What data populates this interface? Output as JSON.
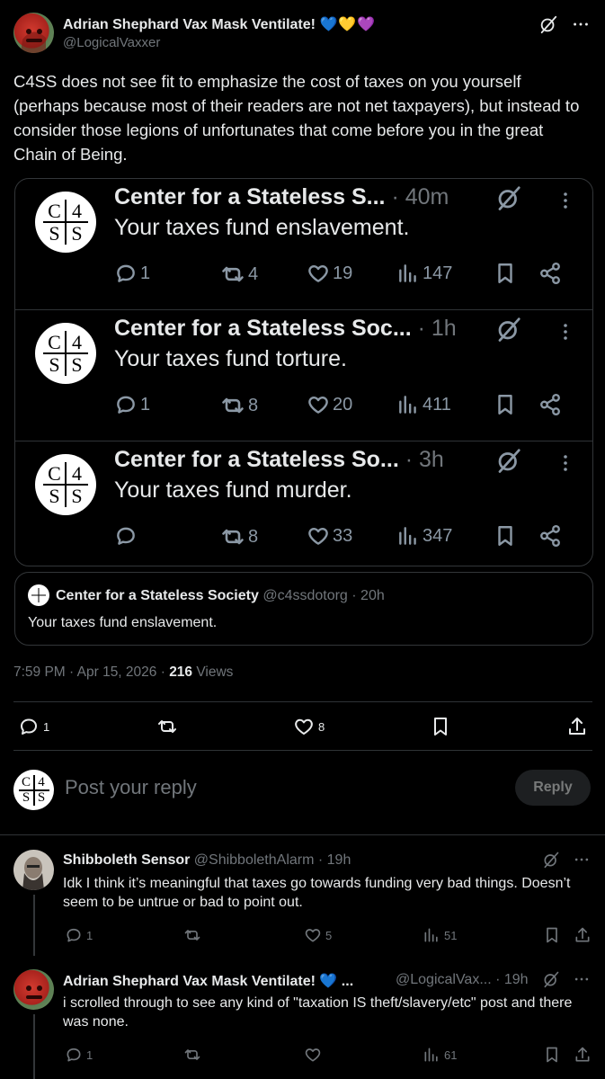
{
  "main_tweet": {
    "author_name": "Adrian Shephard Vax Mask Ventilate!",
    "author_hearts": "💙💛💜",
    "handle": "@LogicalVaxxer",
    "text": "C4SS does not see fit to emphasize the cost of taxes on you yourself (perhaps because most of their readers are not net taxpayers), but instead to consider those legions of unfortunates that come before you in the great Chain of Being.",
    "timestamp": "7:59 PM · Apr 15, 2026 · ",
    "views_count": "216",
    "views_label": " Views",
    "replies": "1",
    "likes": "8"
  },
  "image_posts": [
    {
      "name": "Center for a Stateless S...",
      "time": " · 40m",
      "text": "Your taxes fund enslavement.",
      "replies": "1",
      "reposts": "4",
      "likes": "19",
      "views": "147"
    },
    {
      "name": "Center for a Stateless Soc...",
      "time": " · 1h",
      "text": "Your taxes fund torture.",
      "replies": "1",
      "reposts": "8",
      "likes": "20",
      "views": "411"
    },
    {
      "name": "Center for a Stateless So...",
      "time": " · 3h",
      "text": "Your taxes fund murder.",
      "replies": "",
      "reposts": "8",
      "likes": "33",
      "views": "347"
    }
  ],
  "logo_letters": [
    "C",
    "4",
    "S",
    "S"
  ],
  "quote": {
    "name": "Center for a Stateless Society",
    "handle_time": " @c4ssdotorg · 20h",
    "text": "Your taxes fund enslavement."
  },
  "composer": {
    "placeholder": "Post your reply",
    "button": "Reply"
  },
  "replies": [
    {
      "name": "Shibboleth Sensor",
      "handle_time": " @ShibbolethAlarm · 19h",
      "text": "Idk I think it’s meaningful that taxes go towards funding very bad things. Doesn’t seem to be untrue or bad to point out.",
      "replies": "1",
      "reposts": "",
      "likes": "5",
      "views": "51"
    },
    {
      "name": "Adrian Shephard Vax Mask Ventilate! 💙 ...",
      "handle_time": "@LogicalVax... · 19h",
      "text": "i scrolled through to see any kind of \"taxation IS theft/slavery/etc\" post and there was none.",
      "replies": "1",
      "reposts": "",
      "likes": "",
      "views": "61"
    }
  ],
  "icons": {
    "grok": "grok-icon",
    "more": "more-icon",
    "reply": "reply-icon",
    "repost": "repost-icon",
    "like": "like-icon",
    "views": "views-icon",
    "bookmark": "bookmark-icon",
    "share": "share-icon"
  }
}
